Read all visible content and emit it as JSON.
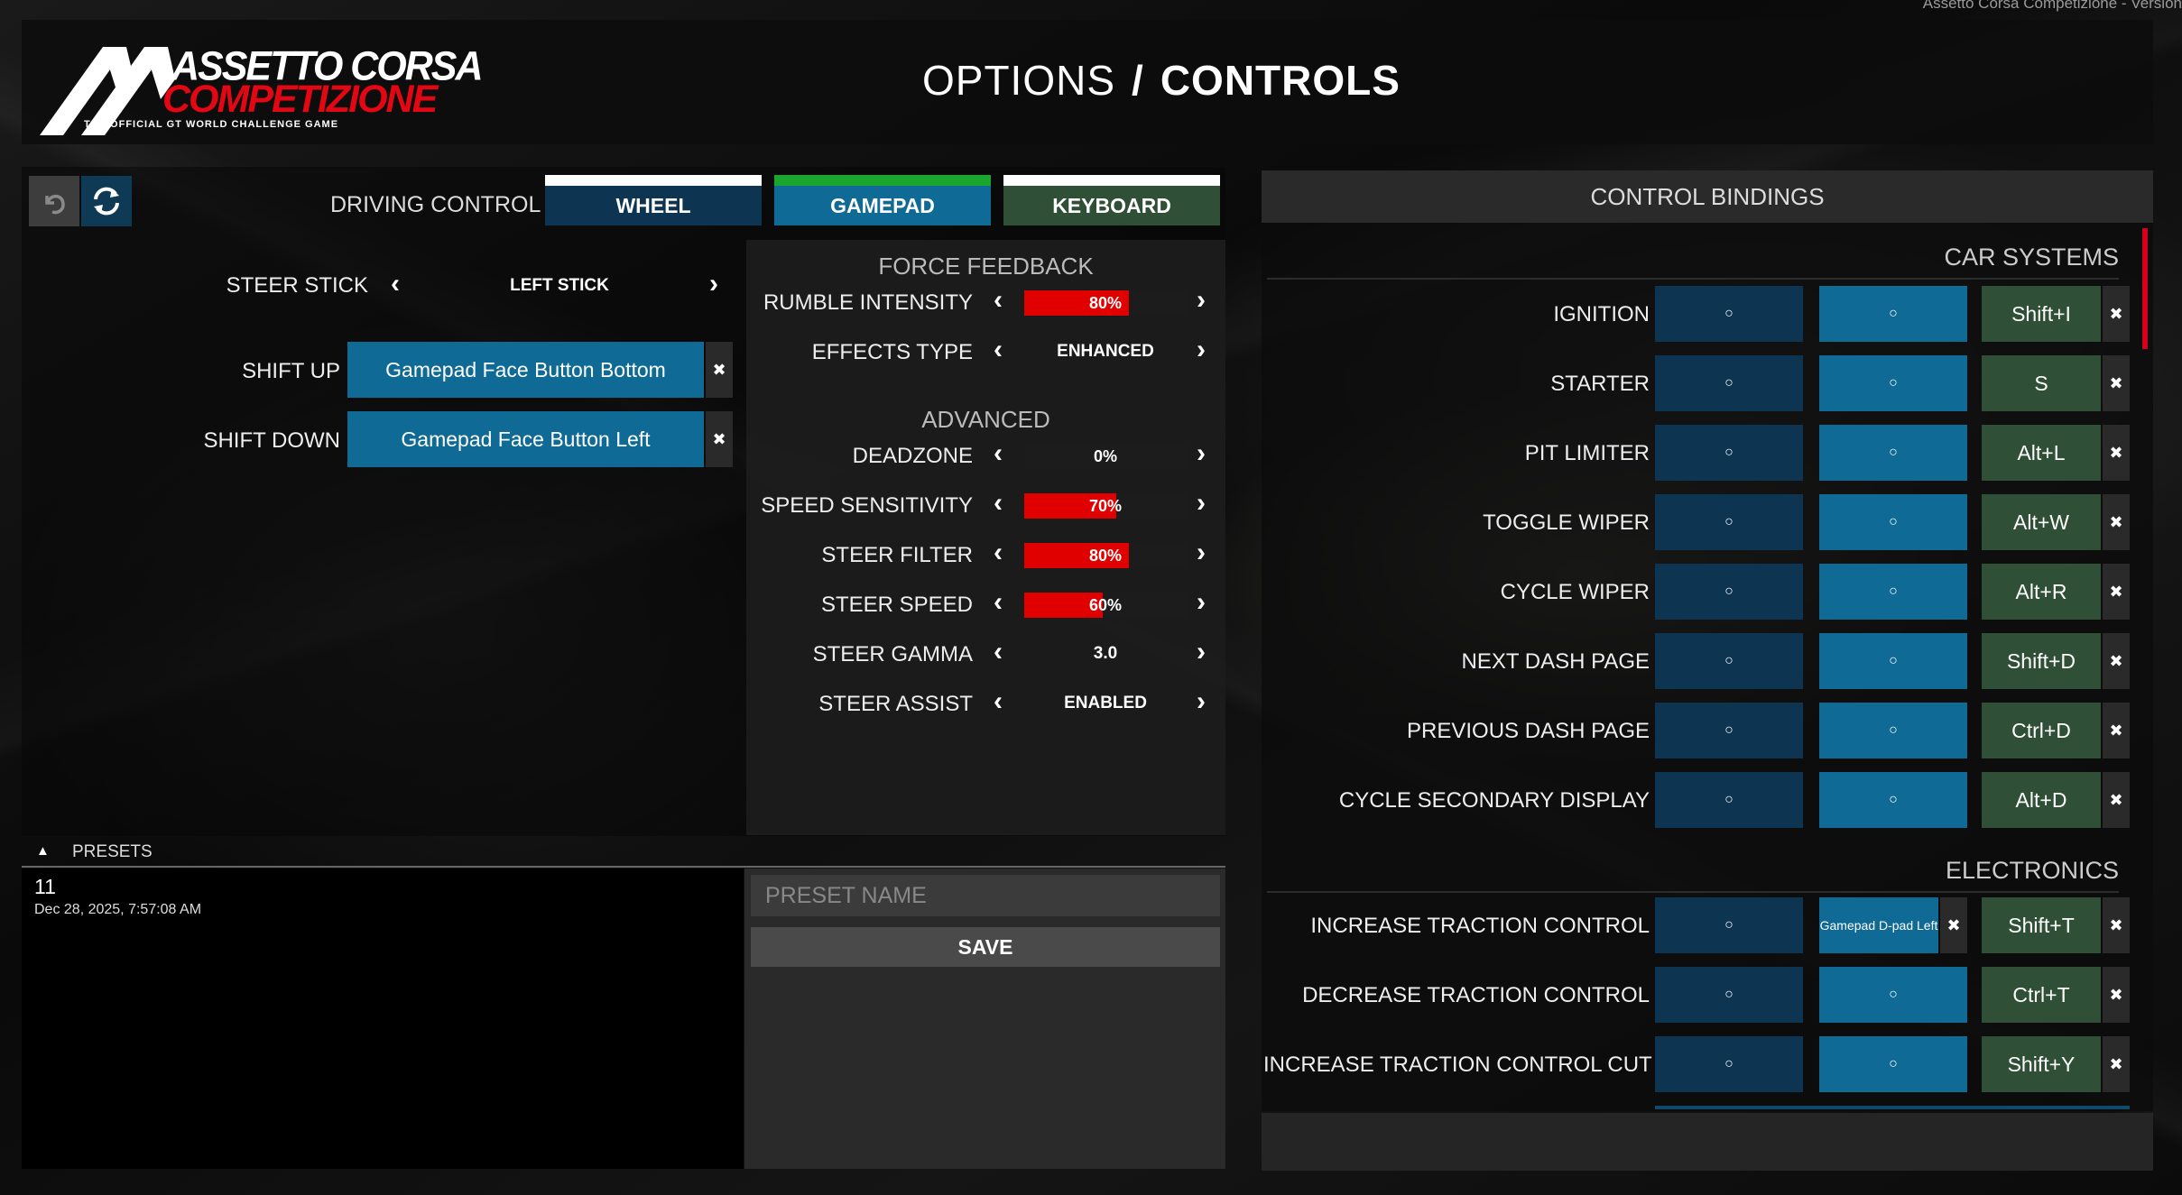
{
  "window_title": "Assetto Corsa Competizione - Version",
  "header": {
    "logo_line1": "ASSETTO CORSA",
    "logo_line2": "COMPETIZIONE",
    "logo_tagline": "THE OFFICIAL GT WORLD CHALLENGE GAME",
    "title_light": "OPTIONS",
    "title_sep": "/",
    "title_strong": "CONTROLS"
  },
  "toolbar": {
    "undo_icon": "undo-icon",
    "reload_icon": "reload-icon"
  },
  "driving_control": {
    "label": "DRIVING CONTROL",
    "tabs": [
      {
        "label": "WHEEL",
        "color": "#0d3450"
      },
      {
        "label": "GAMEPAD",
        "color": "#0f6a95",
        "accent": "#1aa52e"
      },
      {
        "label": "KEYBOARD",
        "color": "#2f4f36"
      }
    ],
    "selected": "GAMEPAD"
  },
  "steer_stick": {
    "label": "STEER STICK",
    "value": "LEFT STICK"
  },
  "shift_up": {
    "label": "SHIFT UP",
    "binding": "Gamepad Face Button Bottom",
    "clear": "✖"
  },
  "shift_down": {
    "label": "SHIFT DOWN",
    "binding": "Gamepad Face Button Left",
    "clear": "✖"
  },
  "force_feedback": {
    "heading": "FORCE FEEDBACK",
    "rows": [
      {
        "label": "RUMBLE INTENSITY",
        "value": "80%",
        "fill": 0.8,
        "type": "bar"
      },
      {
        "label": "EFFECTS TYPE",
        "value": "ENHANCED",
        "type": "text"
      }
    ]
  },
  "advanced": {
    "heading": "ADVANCED",
    "rows": [
      {
        "label": "DEADZONE",
        "value": "0%",
        "fill": 0.0,
        "type": "bar"
      },
      {
        "label": "SPEED SENSITIVITY",
        "value": "70%",
        "fill": 0.7,
        "type": "bar"
      },
      {
        "label": "STEER FILTER",
        "value": "80%",
        "fill": 0.8,
        "type": "bar"
      },
      {
        "label": "STEER SPEED",
        "value": "60%",
        "fill": 0.6,
        "type": "bar"
      },
      {
        "label": "STEER GAMMA",
        "value": "3.0",
        "type": "text"
      },
      {
        "label": "STEER ASSIST",
        "value": "ENABLED",
        "type": "text"
      }
    ]
  },
  "presets": {
    "label": "PRESETS",
    "items": [
      {
        "name": "11",
        "date": "Dec 28, 2025, 7:57:08 AM"
      }
    ],
    "name_placeholder": "PRESET NAME",
    "save_label": "SAVE"
  },
  "control_bindings": {
    "heading": "CONTROL BINDINGS",
    "sections": [
      {
        "title": "CAR SYSTEMS",
        "rows": [
          {
            "label": "IGNITION",
            "wheel": "○",
            "gamepad": "○",
            "keyboard": "Shift+I",
            "clear": "✖"
          },
          {
            "label": "STARTER",
            "wheel": "○",
            "gamepad": "○",
            "keyboard": "S",
            "clear": "✖"
          },
          {
            "label": "PIT LIMITER",
            "wheel": "○",
            "gamepad": "○",
            "keyboard": "Alt+L",
            "clear": "✖"
          },
          {
            "label": "TOGGLE WIPER",
            "wheel": "○",
            "gamepad": "○",
            "keyboard": "Alt+W",
            "clear": "✖"
          },
          {
            "label": "CYCLE WIPER",
            "wheel": "○",
            "gamepad": "○",
            "keyboard": "Alt+R",
            "clear": "✖"
          },
          {
            "label": "NEXT DASH PAGE",
            "wheel": "○",
            "gamepad": "○",
            "keyboard": "Shift+D",
            "clear": "✖"
          },
          {
            "label": "PREVIOUS DASH PAGE",
            "wheel": "○",
            "gamepad": "○",
            "keyboard": "Ctrl+D",
            "clear": "✖"
          },
          {
            "label": "CYCLE SECONDARY DISPLAY",
            "wheel": "○",
            "gamepad": "○",
            "keyboard": "Alt+D",
            "clear": "✖"
          }
        ]
      },
      {
        "title": "ELECTRONICS",
        "rows": [
          {
            "label": "INCREASE TRACTION CONTROL",
            "wheel": "○",
            "gamepad": "Gamepad D-pad Left",
            "gamepad_clear": "✖",
            "keyboard": "Shift+T",
            "clear": "✖"
          },
          {
            "label": "DECREASE TRACTION CONTROL",
            "wheel": "○",
            "gamepad": "○",
            "keyboard": "Ctrl+T",
            "clear": "✖"
          },
          {
            "label": "INCREASE TRACTION CONTROL CUT",
            "wheel": "○",
            "gamepad": "○",
            "keyboard": "Shift+Y",
            "clear": "✖"
          }
        ]
      }
    ]
  },
  "colors": {
    "accent_red": "#e00000",
    "scroll_red": "#d6001c",
    "gamepad_green": "#1aa52e"
  }
}
